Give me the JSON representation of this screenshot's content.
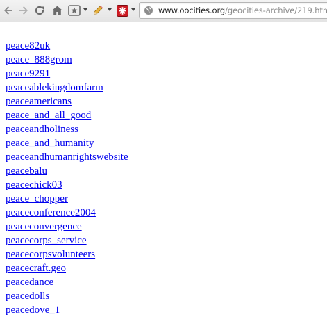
{
  "browser": {
    "icons": {
      "back": "back-arrow-icon",
      "forward": "forward-arrow-icon",
      "reload": "reload-icon",
      "home": "home-icon",
      "bookmark": "bookmark-star-icon",
      "pencil": "pencil-icon",
      "extension": "red-extension-icon",
      "site": "globe-icon"
    },
    "url_host": "www.oocities.org",
    "url_path": "/geocities-archive/219.htm"
  },
  "links": [
    "peace82uk",
    "peace_888grom",
    "peace9291",
    "peaceablekingdomfarm",
    "peaceamericans",
    "peace_and_all_good",
    "peaceandholiness",
    "peace_and_humanity",
    "peaceandhumanrightswebsite",
    "peacebalu",
    "peacechick03",
    "peace_chopper",
    "peaceconference2004",
    "peaceconvergence",
    "peacecorps_service",
    "peacecorpsvolunteers",
    "peacecraft.geo",
    "peacedance",
    "peacedolls",
    "peacedove_1"
  ],
  "colors": {
    "link": "#0000ee",
    "toolbar": "#ececec",
    "extension": "#cc1a22"
  }
}
